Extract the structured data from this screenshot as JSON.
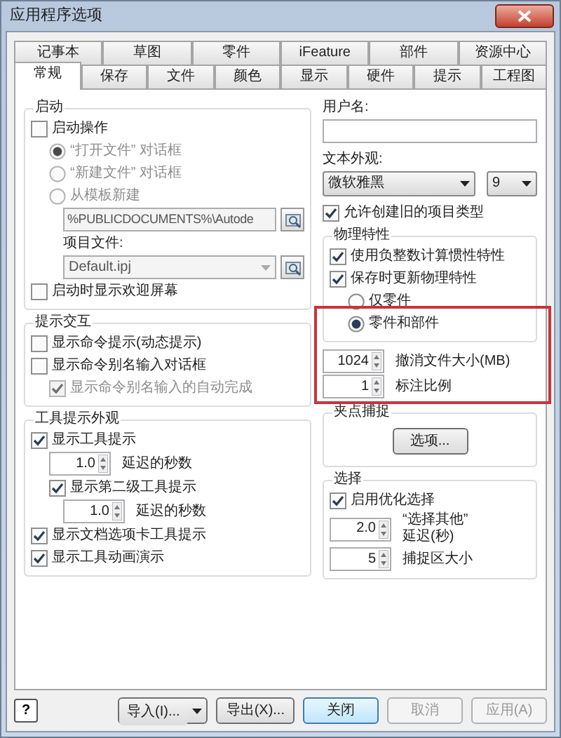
{
  "window": {
    "title": "应用程序选项"
  },
  "tabs_back": [
    {
      "label": "记事本",
      "selected": false
    },
    {
      "label": "草图",
      "selected": false
    },
    {
      "label": "零件",
      "selected": false
    },
    {
      "label": "iFeature",
      "selected": false
    },
    {
      "label": "部件",
      "selected": false
    },
    {
      "label": "资源中心",
      "selected": false
    }
  ],
  "tabs_front": [
    {
      "label": "常规",
      "selected": true
    },
    {
      "label": "保存",
      "selected": false
    },
    {
      "label": "文件",
      "selected": false
    },
    {
      "label": "颜色",
      "selected": false
    },
    {
      "label": "显示",
      "selected": false
    },
    {
      "label": "硬件",
      "selected": false
    },
    {
      "label": "提示",
      "selected": false
    },
    {
      "label": "工程图",
      "selected": false
    }
  ],
  "left": [
    {
      "kind": "group",
      "title": "启动",
      "items": [
        {
          "kind": "checkbox",
          "label": "启动操作",
          "checked": false,
          "disabled": false,
          "children": [
            {
              "kind": "radio",
              "label": "“打开文件” 对话框",
              "selected": true,
              "disabled": true
            },
            {
              "kind": "radio",
              "label": "“新建文件” 对话框",
              "selected": false,
              "disabled": true
            },
            {
              "kind": "radio",
              "label": "从模板新建",
              "selected": false,
              "disabled": true,
              "children": [
                {
                  "kind": "path_field",
                  "value": "%PUBLICDOCUMENTS%\\Autode",
                  "disabled": true
                },
                {
                  "kind": "label",
                  "text": "项目文件:"
                },
                {
                  "kind": "file_combo",
                  "value": "Default.ipj",
                  "disabled": true
                }
              ]
            }
          ]
        },
        {
          "kind": "checkbox",
          "label": "启动时显示欢迎屏幕",
          "checked": false,
          "disabled": false
        }
      ]
    },
    {
      "kind": "group",
      "title": "提示交互",
      "items": [
        {
          "kind": "checkbox",
          "label": "显示命令提示(动态提示)",
          "checked": false,
          "disabled": false
        },
        {
          "kind": "checkbox",
          "label": "显示命令别名输入对话框",
          "checked": false,
          "disabled": false,
          "children": [
            {
              "kind": "checkbox",
              "label": "显示命令别名输入的自动完成",
              "checked": true,
              "disabled": true
            }
          ]
        }
      ]
    },
    {
      "kind": "group",
      "title": "工具提示外观",
      "items": [
        {
          "kind": "checkbox",
          "label": "显示工具提示",
          "checked": true,
          "disabled": false,
          "children": [
            {
              "kind": "spinner",
              "value": "1.0",
              "labels": [
                "延迟的秒数"
              ]
            },
            {
              "kind": "checkbox",
              "label": "显示第二级工具提示",
              "checked": true,
              "disabled": false,
              "children": [
                {
                  "kind": "spinner",
                  "value": "1.0",
                  "labels": [
                    "延迟的秒数"
                  ]
                }
              ]
            }
          ]
        },
        {
          "kind": "checkbox",
          "label": "显示文档选项卡工具提示",
          "checked": true,
          "disabled": false
        },
        {
          "kind": "checkbox",
          "label": "显示工具动画演示",
          "checked": true,
          "disabled": false
        }
      ]
    }
  ],
  "right": [
    {
      "kind": "label",
      "text": "用户名:"
    },
    {
      "kind": "text_field"
    },
    {
      "kind": "label",
      "text": "文本外观:"
    },
    {
      "kind": "combo_row",
      "combos": [
        {
          "value": "微软雅黑"
        },
        {
          "value": "9"
        }
      ]
    },
    {
      "kind": "checkbox",
      "label": "允许创建旧的项目类型",
      "checked": true,
      "disabled": false
    },
    {
      "kind": "group",
      "title": "物理特性",
      "items": [
        {
          "kind": "checkbox",
          "label": "使用负整数计算惯性特性",
          "checked": true,
          "disabled": false
        },
        {
          "kind": "checkbox",
          "label": "保存时更新物理特性",
          "checked": true,
          "disabled": false,
          "children": [
            {
              "kind": "radio",
              "label": "仅零件",
              "selected": false,
              "disabled": false
            },
            {
              "kind": "radio",
              "label": "零件和部件",
              "selected": true,
              "disabled": false
            }
          ]
        }
      ]
    },
    {
      "kind": "highlight",
      "children": [
        {
          "kind": "spinner",
          "value": "1024",
          "labels": [
            "撤消文件大小(MB)"
          ]
        },
        {
          "kind": "spinner",
          "value": "1",
          "labels": [
            "标注比例"
          ]
        }
      ]
    },
    {
      "kind": "group",
      "title": "夹点捕捉",
      "items": [
        {
          "kind": "button",
          "label": "选项..."
        }
      ]
    },
    {
      "kind": "group",
      "title": "选择",
      "items": [
        {
          "kind": "checkbox",
          "label": "启用优化选择",
          "checked": true,
          "disabled": false
        },
        {
          "kind": "spinner",
          "value": "2.0",
          "labels": [
            "“选择其他”",
            "延迟(秒)"
          ]
        },
        {
          "kind": "spinner",
          "value": "5",
          "labels": [
            "捕捉区大小"
          ]
        }
      ]
    }
  ],
  "footer": {
    "help": "?",
    "buttons": [
      {
        "label": "导入(I)...",
        "kind": "split",
        "disabled": false,
        "default": false
      },
      {
        "label": "导出(X)...",
        "kind": "plain",
        "disabled": false,
        "default": false
      },
      {
        "label": "关闭",
        "kind": "plain",
        "disabled": false,
        "default": true
      },
      {
        "label": "取消",
        "kind": "plain",
        "disabled": true,
        "default": false
      },
      {
        "label": "应用(A)",
        "kind": "plain",
        "disabled": true,
        "default": false
      }
    ]
  }
}
